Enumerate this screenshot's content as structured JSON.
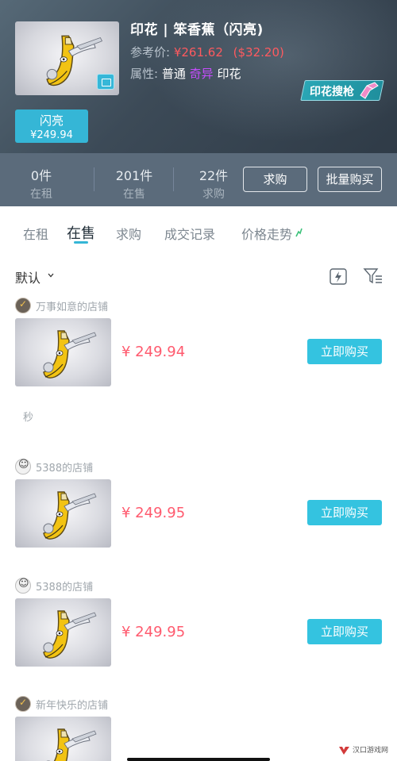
{
  "header": {
    "title": "印花 | 笨香蕉（闪亮)",
    "ref_label": "参考价:",
    "ref_price_cny": "¥261.62",
    "ref_price_usd": "($32.20)",
    "attr_label": "属性:",
    "attr_normal": "普通",
    "attr_exotic": "奇异",
    "attr_sticker": "印花",
    "sticker_search_label": "印花搜枪",
    "wear_name": "闪亮",
    "wear_price": "¥249.94"
  },
  "stats": {
    "rent": {
      "count": "0件",
      "label": "在租"
    },
    "sale": {
      "count": "201件",
      "label": "在售"
    },
    "want": {
      "count": "22件",
      "label": "求购"
    },
    "want_button": "求购",
    "bulk_buy_button": "批量购买"
  },
  "tabs": [
    "在租",
    "在售",
    "求购",
    "成交记录",
    "价格走势"
  ],
  "active_tab": "在售",
  "sort": {
    "label": "默认"
  },
  "listings": [
    {
      "shop": "万事如意的店铺",
      "price": "¥ 249.94",
      "buy_label": "立即购买",
      "avatar": "dark"
    },
    {
      "shop": "5388的店铺",
      "price": "¥ 249.95",
      "buy_label": "立即购买",
      "avatar": "light"
    },
    {
      "shop": "5388的店铺",
      "price": "¥ 249.95",
      "buy_label": "立即购买",
      "avatar": "light"
    },
    {
      "shop": "新年快乐的店铺",
      "price": "",
      "buy_label": "",
      "avatar": "dark"
    }
  ],
  "second_note": "秒",
  "watermark": "汉口游戏网",
  "colors": {
    "accent": "#34c3e0",
    "price": "#ff5a6e",
    "exotic": "#c74cff",
    "header_bg": "#3c4a57",
    "stats_bg": "#5b6b7b"
  }
}
